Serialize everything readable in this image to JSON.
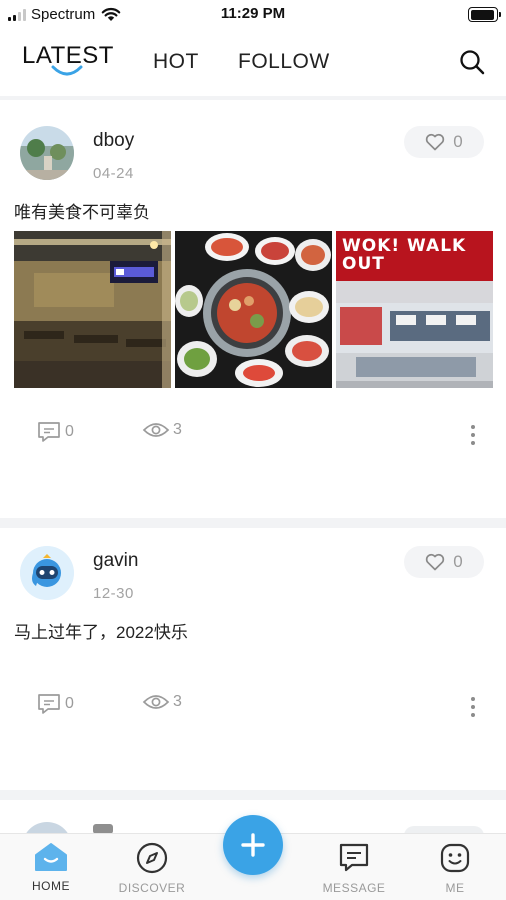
{
  "status_bar": {
    "carrier": "Spectrum",
    "time": "11:29 PM",
    "battery_level": 0.95
  },
  "tabs": [
    {
      "label": "LATEST",
      "active": true
    },
    {
      "label": "HOT",
      "active": false
    },
    {
      "label": "FOLLOW",
      "active": false
    }
  ],
  "colors": {
    "accent": "#3aa3e6",
    "divider": "#f2f3f5",
    "muted": "#9a9a9a"
  },
  "posts": [
    {
      "username": "dboy",
      "date": "04-24",
      "likes": "0",
      "text": "唯有美食不可辜负",
      "comments": "0",
      "views": "3",
      "has_images": true,
      "images": [
        "restaurant-interior-photo",
        "hotpot-table-photo",
        "wok-walk-out-storefront-photo"
      ],
      "image_sign_text": "WOK! WALK OUT"
    },
    {
      "username": "gavin",
      "date": "12-30",
      "likes": "0",
      "text": "马上过年了，2022快乐",
      "comments": "0",
      "views": "3",
      "has_images": false
    }
  ],
  "bottom_nav": [
    {
      "label": "HOME",
      "icon": "home-icon",
      "active": true
    },
    {
      "label": "DISCOVER",
      "icon": "compass-icon",
      "active": false
    },
    {
      "label": "MESSAGE",
      "icon": "message-icon",
      "active": false
    },
    {
      "label": "ME",
      "icon": "smiley-icon",
      "active": false
    }
  ],
  "fab": {
    "icon": "plus-icon"
  }
}
